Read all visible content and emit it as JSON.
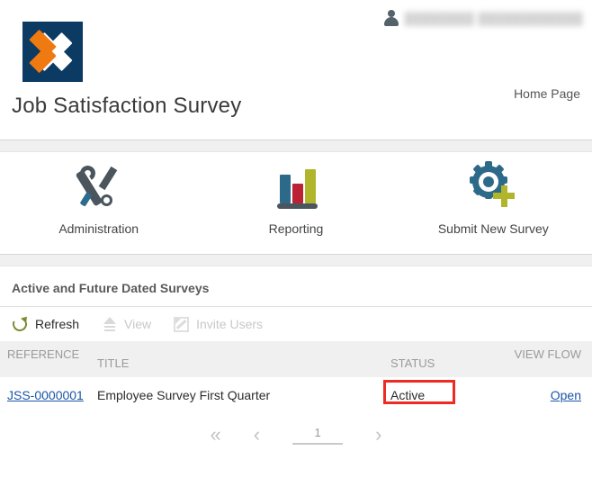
{
  "header": {
    "app_title": "Job Satisfaction Survey",
    "home_link": "Home Page",
    "user_name": "████████  ████████████",
    "logo_colors": {
      "background": "#0b3a63",
      "accent": "#f07a12",
      "secondary": "#ffffff"
    }
  },
  "nav_tiles": [
    {
      "label": "Administration",
      "icon": "tools-icon"
    },
    {
      "label": "Reporting",
      "icon": "bar-chart-icon"
    },
    {
      "label": "Submit New Survey",
      "icon": "gear-plus-icon"
    }
  ],
  "list_section": {
    "title": "Active and Future Dated Surveys",
    "toolbar": [
      {
        "label": "Refresh",
        "icon": "refresh-icon",
        "enabled": true
      },
      {
        "label": "View",
        "icon": "view-icon",
        "enabled": false
      },
      {
        "label": "Invite Users",
        "icon": "invite-users-icon",
        "enabled": false
      }
    ],
    "columns": [
      "REFERENCE",
      "TITLE",
      "STATUS",
      "VIEW FLOW"
    ],
    "rows": [
      {
        "reference": "JSS-0000001",
        "title": "Employee Survey First Quarter",
        "status": "Active",
        "view_flow": "Open"
      }
    ],
    "highlight": {
      "target": "status-cell",
      "color": "#ee2a22"
    }
  },
  "pager": {
    "first_label": "«",
    "prev_label": "‹",
    "page_value": "1",
    "next_label": "›"
  },
  "colors": {
    "link": "#1a55a8",
    "band": "#f0f0f0",
    "header_row": "#f0f0f0",
    "muted_text": "#9a9a9a",
    "accent_green": "#7b8a2e",
    "accent_blue": "#2d6a8a"
  }
}
